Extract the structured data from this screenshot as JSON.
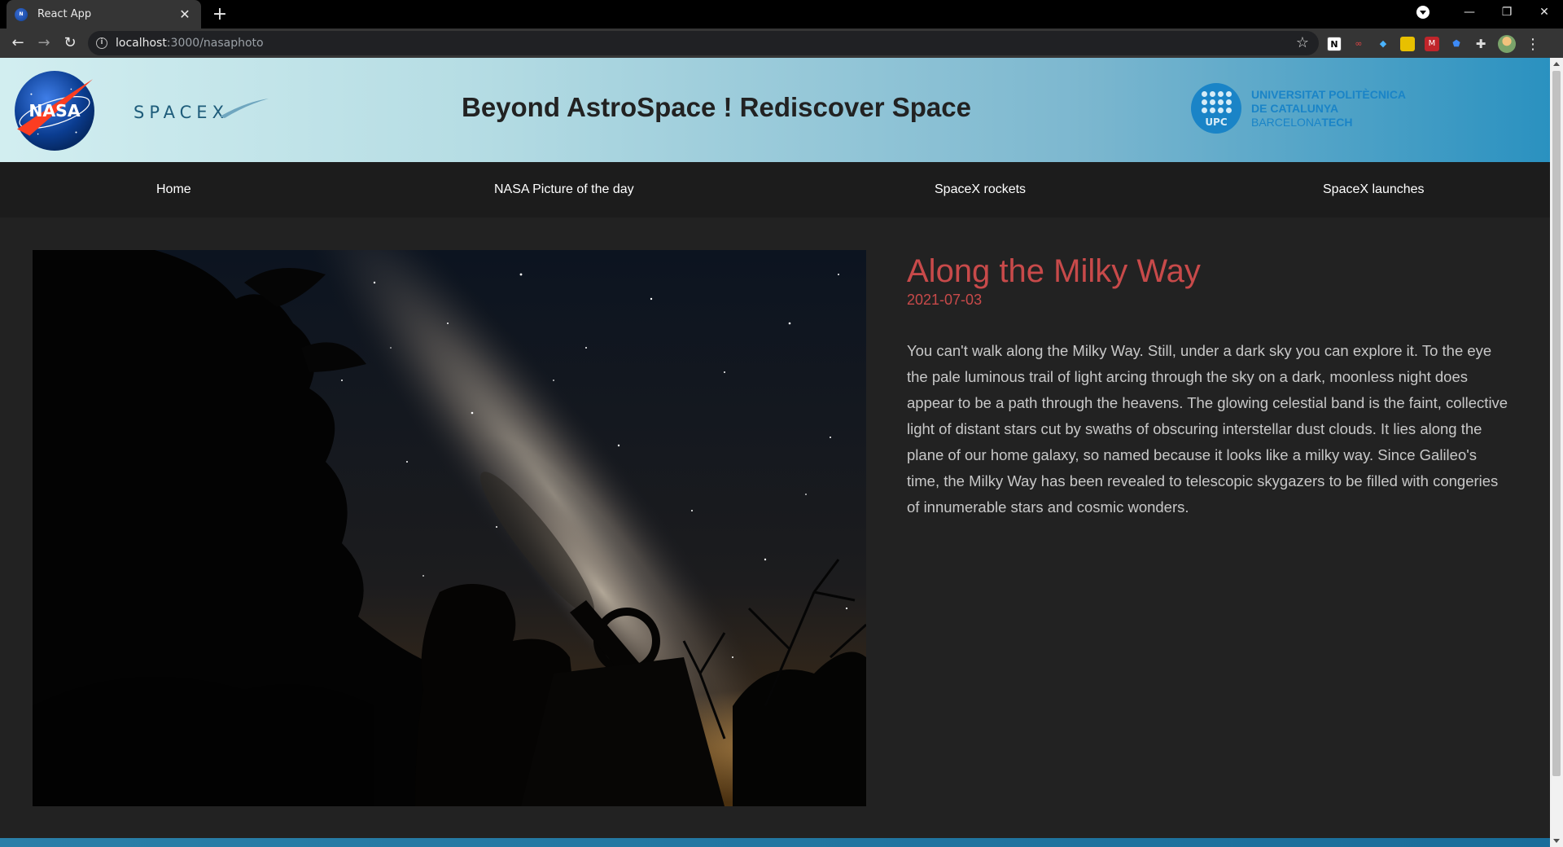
{
  "browser": {
    "tab_title": "React App",
    "tab_close": "✕",
    "new_tab": "+",
    "url_host": "localhost",
    "url_rest": ":3000/nasaphoto",
    "window_controls": {
      "minimize": "—",
      "restore": "❐",
      "close": "✕"
    }
  },
  "header": {
    "title": "Beyond AstroSpace ! Rediscover Space",
    "nasa_logo_text": "NASA",
    "spacex_logo_text": "SPACEX",
    "upc": {
      "badge": "UPC",
      "line1": "UNIVERSITAT POLITÈCNICA",
      "line2": "DE CATALUNYA",
      "line3_a": "BARCELONA",
      "line3_b": "TECH"
    }
  },
  "nav": {
    "items": [
      {
        "label": "Home"
      },
      {
        "label": "NASA Picture of the day"
      },
      {
        "label": "SpaceX rockets"
      },
      {
        "label": "SpaceX launches"
      }
    ]
  },
  "apod": {
    "title": "Along the Milky Way",
    "date": "2021-07-03",
    "explanation": "You can't walk along the Milky Way. Still, under a dark sky you can explore it. To the eye the pale luminous trail of light arcing through the sky on a dark, moonless night does appear to be a path through the heavens. The glowing celestial band is the faint, collective light of distant stars cut by swaths of obscuring interstellar dust clouds. It lies along the plane of our home galaxy, so named because it looks like a milky way. Since Galileo's time, the Milky Way has been revealed to telescopic skygazers to be filled with congeries of innumerable stars and cosmic wonders."
  },
  "colors": {
    "accent": "#c84a4a",
    "page_bg": "#222222",
    "nav_bg": "#1c1c1c",
    "upc_blue": "#1a84c7"
  }
}
